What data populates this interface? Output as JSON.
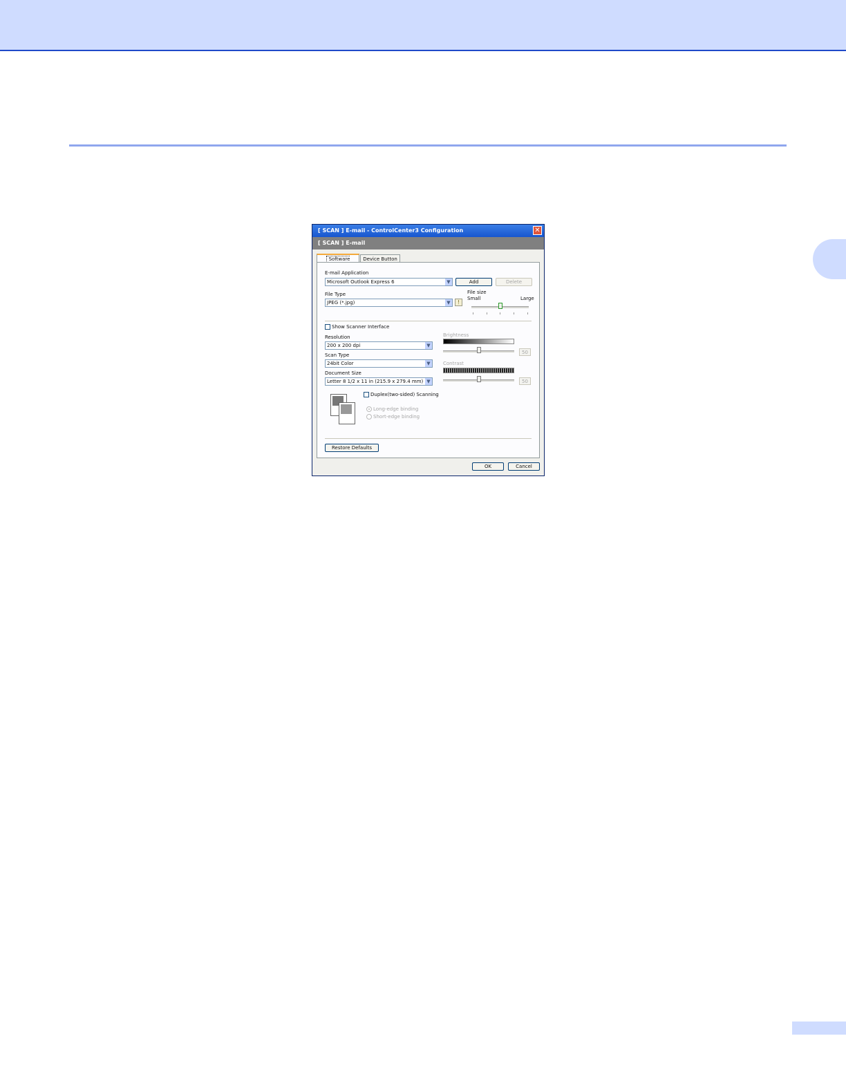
{
  "dialog": {
    "title": "[ SCAN ]   E-mail - ControlCenter3 Configuration",
    "close_glyph": "✕",
    "subheader": "[ SCAN ]   E-mail",
    "tabs": [
      "Software Button",
      "Device Button"
    ],
    "email_application": {
      "label": "E-mail Application",
      "value": "Microsoft Outlook Express 6",
      "add_label": "Add",
      "delete_label": "Delete"
    },
    "file_type": {
      "label": "File Type",
      "value": "JPEG (*.jpg)"
    },
    "file_size": {
      "label": "File size",
      "small_label": "Small",
      "large_label": "Large",
      "level": 0.5
    },
    "show_scanner_interface": {
      "label": "Show Scanner Interface",
      "checked": false
    },
    "resolution": {
      "label": "Resolution",
      "value": "200 x 200 dpi"
    },
    "scan_type": {
      "label": "Scan Type",
      "value": "24bit Color"
    },
    "document_size": {
      "label": "Document Size",
      "value": "Letter 8 1/2 x 11 in (215.9 x 279.4 mm)"
    },
    "brightness": {
      "label": "Brightness",
      "value": "50"
    },
    "contrast": {
      "label": "Contrast",
      "value": "50"
    },
    "duplex": {
      "label": "Duplex(two-sided) Scanning",
      "checked": false,
      "options": [
        "Long-edge binding",
        "Short-edge binding"
      ]
    },
    "restore_defaults_label": "Restore Defaults",
    "ok_label": "OK",
    "cancel_label": "Cancel"
  }
}
